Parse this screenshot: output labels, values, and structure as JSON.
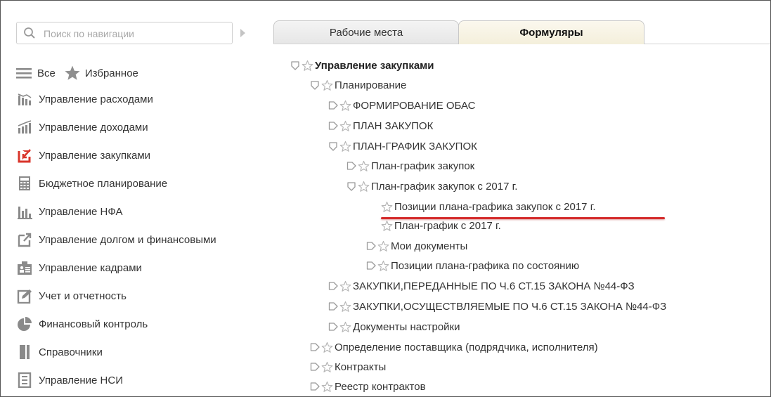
{
  "search": {
    "placeholder": "Поиск по навигации"
  },
  "filters": {
    "all_label": "Все",
    "favorites_label": "Избранное"
  },
  "sidebar": {
    "items": [
      {
        "label": "Управление расходами",
        "icon": "expenses-icon"
      },
      {
        "label": "Управление доходами",
        "icon": "income-icon"
      },
      {
        "label": "Управление закупками",
        "icon": "procurement-icon",
        "accent": "#d9352b"
      },
      {
        "label": "Бюджетное планирование",
        "icon": "calculator-icon"
      },
      {
        "label": "Управление НФА",
        "icon": "bar-chart-icon"
      },
      {
        "label": "Управление долгом и финансовыми",
        "icon": "debt-icon"
      },
      {
        "label": "Управление кадрами",
        "icon": "staff-icon"
      },
      {
        "label": "Учет и отчетность",
        "icon": "edit-report-icon"
      },
      {
        "label": "Финансовый контроль",
        "icon": "pie-chart-icon"
      },
      {
        "label": "Справочники",
        "icon": "book-icon"
      },
      {
        "label": "Управление НСИ",
        "icon": "nsi-icon"
      }
    ]
  },
  "tabs": [
    {
      "label": "Рабочие места",
      "active": false
    },
    {
      "label": "Формуляры",
      "active": true
    }
  ],
  "tree": [
    {
      "label": "Управление закупками",
      "toggle": "expanded",
      "bold": true
    },
    {
      "label": "Планирование",
      "toggle": "expanded"
    },
    {
      "label": "ФОРМИРОВАНИЕ ОБАС",
      "toggle": "collapsed"
    },
    {
      "label": "ПЛАН ЗАКУПОК",
      "toggle": "collapsed"
    },
    {
      "label": "ПЛАН-ГРАФИК ЗАКУПОК",
      "toggle": "expanded"
    },
    {
      "label": "План-график закупок",
      "toggle": "collapsed"
    },
    {
      "label": "План-график закупок с 2017 г.",
      "toggle": "expanded"
    },
    {
      "label": "Позиции плана-графика закупок с 2017 г.",
      "toggle": "none",
      "highlighted": true
    },
    {
      "label": "План-график с 2017 г.",
      "toggle": "none"
    },
    {
      "label": "Мои документы",
      "toggle": "collapsed"
    },
    {
      "label": "Позиции плана-графика по состоянию",
      "toggle": "collapsed"
    },
    {
      "label": "ЗАКУПКИ,ПЕРЕДАННЫЕ ПО Ч.6 СТ.15 ЗАКОНА №44-ФЗ",
      "toggle": "collapsed"
    },
    {
      "label": "ЗАКУПКИ,ОСУЩЕСТВЛЯЕМЫЕ ПО Ч.6 СТ.15 ЗАКОНА №44-ФЗ",
      "toggle": "collapsed"
    },
    {
      "label": "Документы настройки",
      "toggle": "collapsed"
    },
    {
      "label": "Определение поставщика (подрядчика, исполнителя)",
      "toggle": "collapsed"
    },
    {
      "label": "Контракты",
      "toggle": "collapsed"
    },
    {
      "label": "Реестр контрактов",
      "toggle": "collapsed"
    }
  ],
  "colors": {
    "highlight": "#d42b2b",
    "icon_gray": "#8a8a8a",
    "star_gray": "#b5b5b5"
  }
}
